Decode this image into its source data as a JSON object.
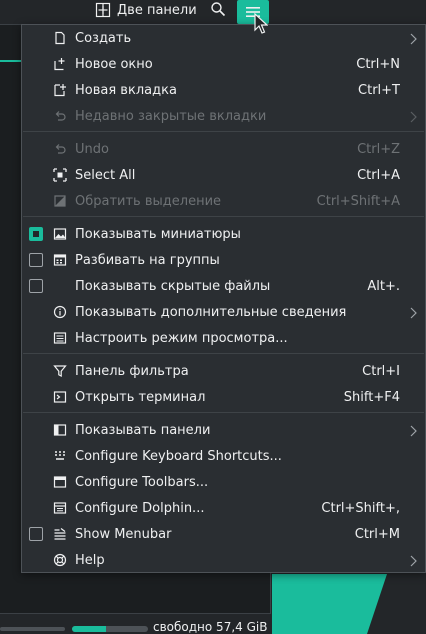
{
  "toolbar": {
    "split_label": "Две панели",
    "split_icon": "split-view-icon",
    "search_icon": "search-icon",
    "menu_icon": "hamburger-menu-icon",
    "accent": "#1abc9c"
  },
  "menu": {
    "items": [
      {
        "label": "Создать",
        "shortcut": "",
        "submenu": true,
        "icon": "new-document-icon",
        "enabled": true
      },
      {
        "label": "Новое окно",
        "shortcut": "Ctrl+N",
        "icon": "new-window-icon",
        "enabled": true
      },
      {
        "label": "Новая вкладка",
        "shortcut": "Ctrl+T",
        "icon": "new-tab-icon",
        "enabled": true
      },
      {
        "label": "Недавно закрытые вкладки",
        "shortcut": "",
        "submenu": true,
        "icon": "undo-icon",
        "enabled": false
      },
      {
        "label": "Undo",
        "shortcut": "Ctrl+Z",
        "icon": "undo-icon",
        "enabled": false
      },
      {
        "label": "Select All",
        "shortcut": "Ctrl+A",
        "icon": "select-all-icon",
        "enabled": true
      },
      {
        "label": "Обратить выделение",
        "shortcut": "Ctrl+Shift+A",
        "icon": "invert-selection-icon",
        "enabled": false
      },
      {
        "label": "Показывать миниатюры",
        "shortcut": "",
        "icon": "image-icon",
        "checkbox": true,
        "checked": true,
        "enabled": true
      },
      {
        "label": "Разбивать на группы",
        "shortcut": "",
        "icon": "group-icon",
        "checkbox": true,
        "checked": false,
        "enabled": true
      },
      {
        "label": "Показывать скрытые файлы",
        "shortcut": "Alt+.",
        "icon": "",
        "checkbox": true,
        "checked": false,
        "enabled": true
      },
      {
        "label": "Показывать дополнительные сведения",
        "shortcut": "",
        "submenu": true,
        "icon": "info-icon",
        "enabled": true
      },
      {
        "label": "Настроить режим просмотра...",
        "shortcut": "",
        "icon": "view-settings-icon",
        "enabled": true
      },
      {
        "label": "Панель фильтра",
        "shortcut": "Ctrl+I",
        "icon": "filter-icon",
        "enabled": true
      },
      {
        "label": "Открыть терминал",
        "shortcut": "Shift+F4",
        "icon": "terminal-icon",
        "enabled": true
      },
      {
        "label": "Показывать панели",
        "shortcut": "",
        "submenu": true,
        "icon": "panels-icon",
        "enabled": true
      },
      {
        "label": "Configure Keyboard Shortcuts...",
        "shortcut": "",
        "icon": "keyboard-icon",
        "enabled": true
      },
      {
        "label": "Configure Toolbars...",
        "shortcut": "",
        "icon": "toolbar-icon",
        "enabled": true
      },
      {
        "label": "Configure Dolphin...",
        "shortcut": "Ctrl+Shift+,",
        "icon": "configure-icon",
        "enabled": true
      },
      {
        "label": "Show Menubar",
        "shortcut": "Ctrl+M",
        "icon": "menubar-icon",
        "checkbox": true,
        "checked": false,
        "enabled": true
      },
      {
        "label": "Help",
        "shortcut": "",
        "submenu": true,
        "icon": "help-icon",
        "enabled": true
      }
    ]
  },
  "status": {
    "free_space": "свободно 57,4 GiB",
    "usage_fraction": 0.45
  }
}
